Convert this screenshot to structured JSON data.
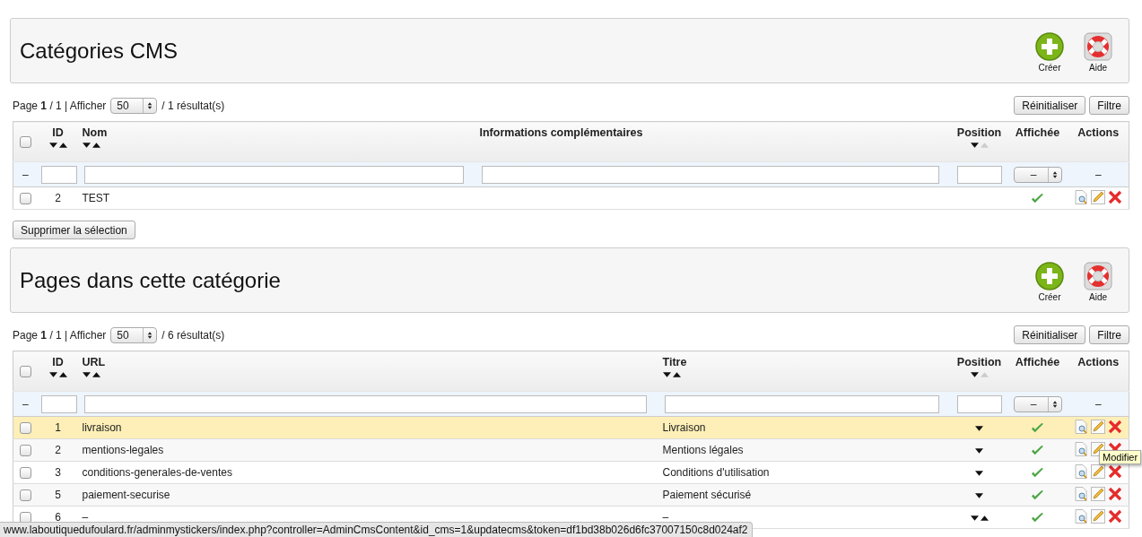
{
  "sections": [
    {
      "title": "Catégories CMS",
      "actions": [
        {
          "label": "Créer",
          "kind": "create"
        },
        {
          "label": "Aide",
          "kind": "help"
        }
      ],
      "pagination": {
        "text": "Page **1** / 1 | Afficher",
        "per_page": "50",
        "results": "/ 1 résultat(s)"
      },
      "toolbar": [
        "Réinitialiser",
        "Filtre"
      ],
      "select_all": {
        "checked": false
      },
      "columns": [
        {
          "label": "ID",
          "kind": "id",
          "sortable": true,
          "sort_up_enabled": true
        },
        {
          "label": "Nom",
          "kind": "text",
          "sortable": true,
          "sort_up_enabled": true
        },
        {
          "label": "Informations complémentaires",
          "kind": "text",
          "sortable": false
        },
        {
          "label": "Position",
          "kind": "position",
          "sortable": true,
          "sort_up_enabled": false
        },
        {
          "label": "Affichée",
          "kind": "displayed",
          "sortable": false
        },
        {
          "label": "Actions",
          "kind": "actions",
          "sortable": false
        }
      ],
      "filter": {
        "lead": "–",
        "select_value": "–",
        "actions": "–"
      },
      "rows": [
        {
          "checked": false,
          "highlighted": false,
          "id": "2",
          "values": [
            "TEST"
          ],
          "displayed": true
        }
      ],
      "bulk_button": "Supprimer la sélection"
    },
    {
      "title": "Pages dans cette catégorie",
      "actions": [
        {
          "label": "Créer",
          "kind": "create"
        },
        {
          "label": "Aide",
          "kind": "help"
        }
      ],
      "pagination": {
        "text": "Page **1** / 1 | Afficher",
        "per_page": "50",
        "results": "/ 6 résultat(s)"
      },
      "toolbar": [
        "Réinitialiser",
        "Filtre"
      ],
      "select_all": {
        "checked": false
      },
      "columns": [
        {
          "label": "ID",
          "kind": "id",
          "sortable": true,
          "sort_up_enabled": true
        },
        {
          "label": "URL",
          "kind": "text",
          "sortable": true,
          "sort_up_enabled": true
        },
        {
          "label": "Titre",
          "kind": "text",
          "sortable": true,
          "sort_up_enabled": true
        },
        {
          "label": "Position",
          "kind": "position",
          "sortable": true,
          "sort_up_enabled": false
        },
        {
          "label": "Affichée",
          "kind": "displayed",
          "sortable": false
        },
        {
          "label": "Actions",
          "kind": "actions",
          "sortable": false
        }
      ],
      "filter": {
        "lead": "–",
        "select_value": "–",
        "actions": "–"
      },
      "rows": [
        {
          "checked": false,
          "highlighted": true,
          "id": "1",
          "values": [
            "livraison",
            "Livraison"
          ],
          "move_down": true,
          "move_up": false,
          "displayed": true
        },
        {
          "checked": false,
          "highlighted": false,
          "id": "2",
          "values": [
            "mentions-legales",
            "Mentions légales"
          ],
          "move_down": true,
          "move_up": false,
          "displayed": true
        },
        {
          "checked": false,
          "highlighted": false,
          "id": "3",
          "values": [
            "conditions-generales-de-ventes",
            "Conditions d'utilisation"
          ],
          "move_down": true,
          "move_up": false,
          "displayed": true
        },
        {
          "checked": false,
          "highlighted": false,
          "id": "5",
          "values": [
            "paiement-securise",
            "Paiement sécurisé"
          ],
          "move_down": true,
          "move_up": false,
          "displayed": true
        },
        {
          "checked": false,
          "highlighted": false,
          "id": "6",
          "values": [
            "–",
            "–"
          ],
          "move_down": true,
          "move_up": true,
          "displayed": true
        }
      ]
    }
  ],
  "tooltip": "Modifier",
  "status_url": "www.laboutiquedufoulard.fr/adminmystickers/index.php?controller=AdminCmsContent&id_cms=1&updatecms&token=df1bd38b026d6fc37007150c8d024af2"
}
